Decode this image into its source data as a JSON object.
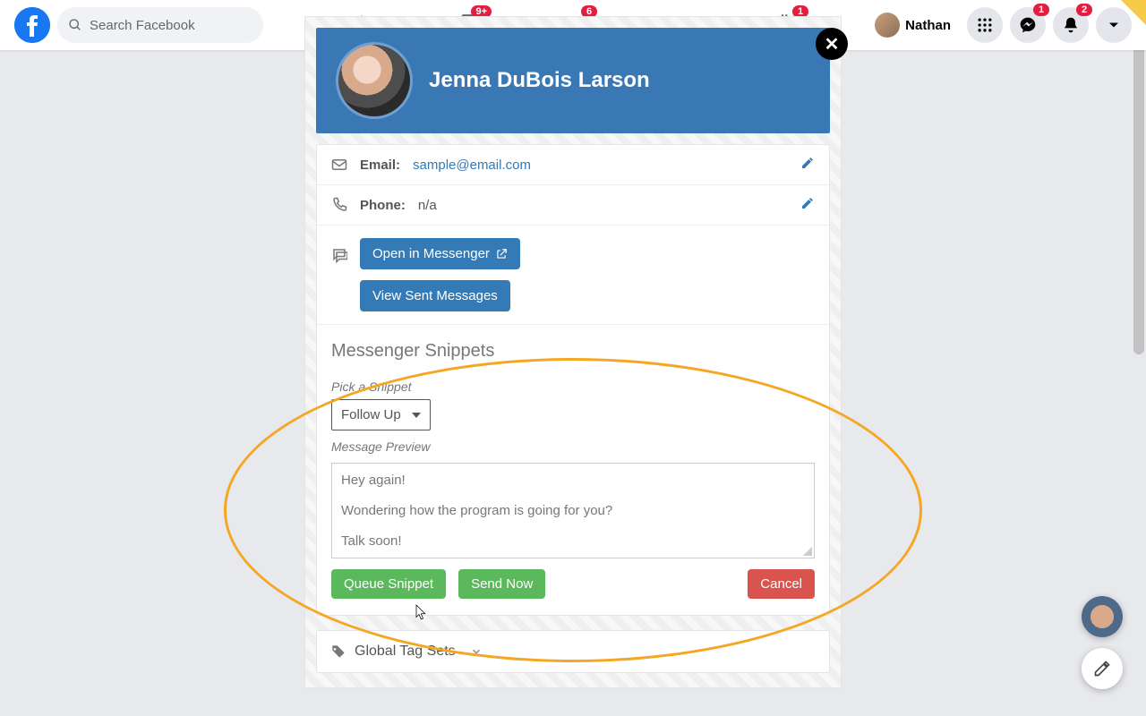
{
  "topbar": {
    "search_placeholder": "Search Facebook",
    "badges": {
      "pages": "9+",
      "watch": "6",
      "groups": "1"
    },
    "profile_name": "Nathan",
    "messenger_badge": "1",
    "notifications_badge": "2"
  },
  "modal": {
    "contact_name": "Jenna DuBois Larson",
    "email_label": "Email:",
    "email_value": "sample@email.com",
    "phone_label": "Phone:",
    "phone_value": "n/a",
    "open_messenger": "Open in Messenger",
    "view_sent": "View Sent Messages",
    "snippets_title": "Messenger Snippets",
    "pick_label": "Pick a Snippet",
    "snippet_selected": "Follow Up",
    "preview_label": "Message Preview",
    "preview_text": "Hey again!\n\nWondering how the program is going for you?\n\nTalk soon!",
    "queue_btn": "Queue Snippet",
    "send_btn": "Send Now",
    "cancel_btn": "Cancel",
    "global_tags": "Global Tag Sets"
  }
}
